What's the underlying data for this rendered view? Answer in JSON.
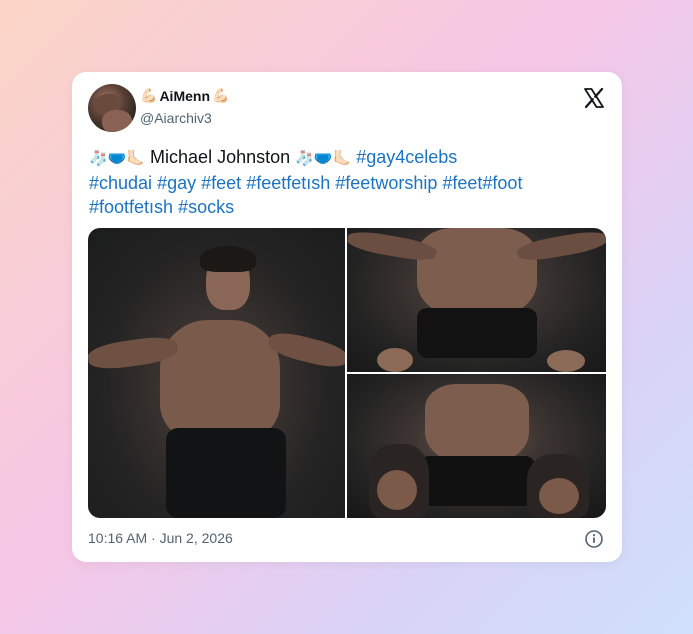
{
  "author": {
    "display_name": "AiMenn",
    "name_emoji": "💪🏻",
    "handle": "@Aiarchiv3"
  },
  "tweet": {
    "lead_emojis": "🧦🩲🦶🏻",
    "name_text": "Michael Johnston",
    "mid_emojis": "🧦🩲🦶🏻",
    "tags": [
      "#gay4celebs",
      "#chudai",
      "#gay",
      "#feet",
      "#feetfetısh",
      "#feetworship",
      "#feet",
      "#foot",
      "#footfetısh",
      "#socks"
    ]
  },
  "media": [
    {
      "icon": "photo-shirtless-man-couch"
    },
    {
      "icon": "photo-torso-couch"
    },
    {
      "icon": "photo-feet-socks-couch"
    }
  ],
  "footer": {
    "timestamp": "10:16 AM · Jun 2, 2026"
  },
  "icons": {
    "platform_logo": "x-logo-icon",
    "info": "info-icon"
  },
  "colors": {
    "hashtag": "#1a74c3",
    "text": "#0f1419",
    "muted": "#536471"
  }
}
